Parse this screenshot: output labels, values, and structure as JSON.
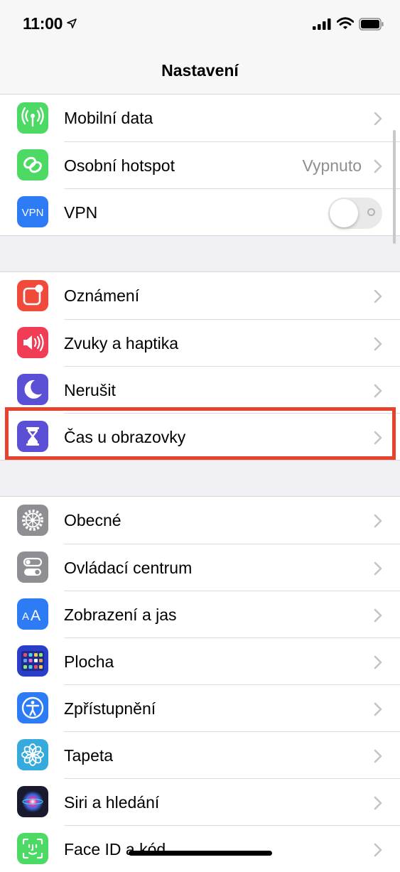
{
  "status_bar": {
    "time": "11:00",
    "icons": [
      "location-arrow-icon",
      "cellular-signal-icon",
      "wifi-icon",
      "battery-icon"
    ]
  },
  "nav": {
    "title": "Nastavení"
  },
  "groups": [
    {
      "rows": [
        {
          "label": "Mobilní data",
          "icon": "antenna-icon",
          "icon_color": "#4cd964",
          "accessory": "chevron"
        },
        {
          "label": "Osobní hotspot",
          "icon": "hotspot-chain-icon",
          "icon_color": "#4cd964",
          "value": "Vypnuto",
          "accessory": "chevron"
        },
        {
          "label": "VPN",
          "icon": "vpn-icon",
          "icon_color": "#2d7cf6",
          "accessory": "toggle",
          "toggle_on": false
        }
      ]
    },
    {
      "rows": [
        {
          "label": "Oznámení",
          "icon": "notifications-icon",
          "icon_color": "#f04a3b",
          "accessory": "chevron"
        },
        {
          "label": "Zvuky a haptika",
          "icon": "speaker-icon",
          "icon_color": "#f03c55",
          "accessory": "chevron"
        },
        {
          "label": "Nerušit",
          "icon": "moon-icon",
          "icon_color": "#5b4fd6",
          "accessory": "chevron"
        },
        {
          "label": "Čas u obrazovky",
          "icon": "hourglass-icon",
          "icon_color": "#5b4fd6",
          "accessory": "chevron",
          "highlighted": true
        }
      ]
    },
    {
      "rows": [
        {
          "label": "Obecné",
          "icon": "gear-icon",
          "icon_color": "#8e8e93",
          "accessory": "chevron"
        },
        {
          "label": "Ovládací centrum",
          "icon": "switches-icon",
          "icon_color": "#8e8e93",
          "accessory": "chevron"
        },
        {
          "label": "Zobrazení a jas",
          "icon": "text-size-icon",
          "icon_color": "#2d7cf6",
          "accessory": "chevron"
        },
        {
          "label": "Plocha",
          "icon": "home-screen-grid-icon",
          "icon_color": "#2b3ec9",
          "accessory": "chevron"
        },
        {
          "label": "Zpřístupnění",
          "icon": "accessibility-icon",
          "icon_color": "#2d7cf6",
          "accessory": "chevron"
        },
        {
          "label": "Tapeta",
          "icon": "wallpaper-flower-icon",
          "icon_color": "#36aadc",
          "accessory": "chevron"
        },
        {
          "label": "Siri a hledání",
          "icon": "siri-icon",
          "icon_color": "#1a1a2e",
          "accessory": "chevron"
        },
        {
          "label": "Face ID a kód",
          "icon": "face-id-icon",
          "icon_color": "#4cd964",
          "accessory": "chevron"
        }
      ]
    }
  ]
}
